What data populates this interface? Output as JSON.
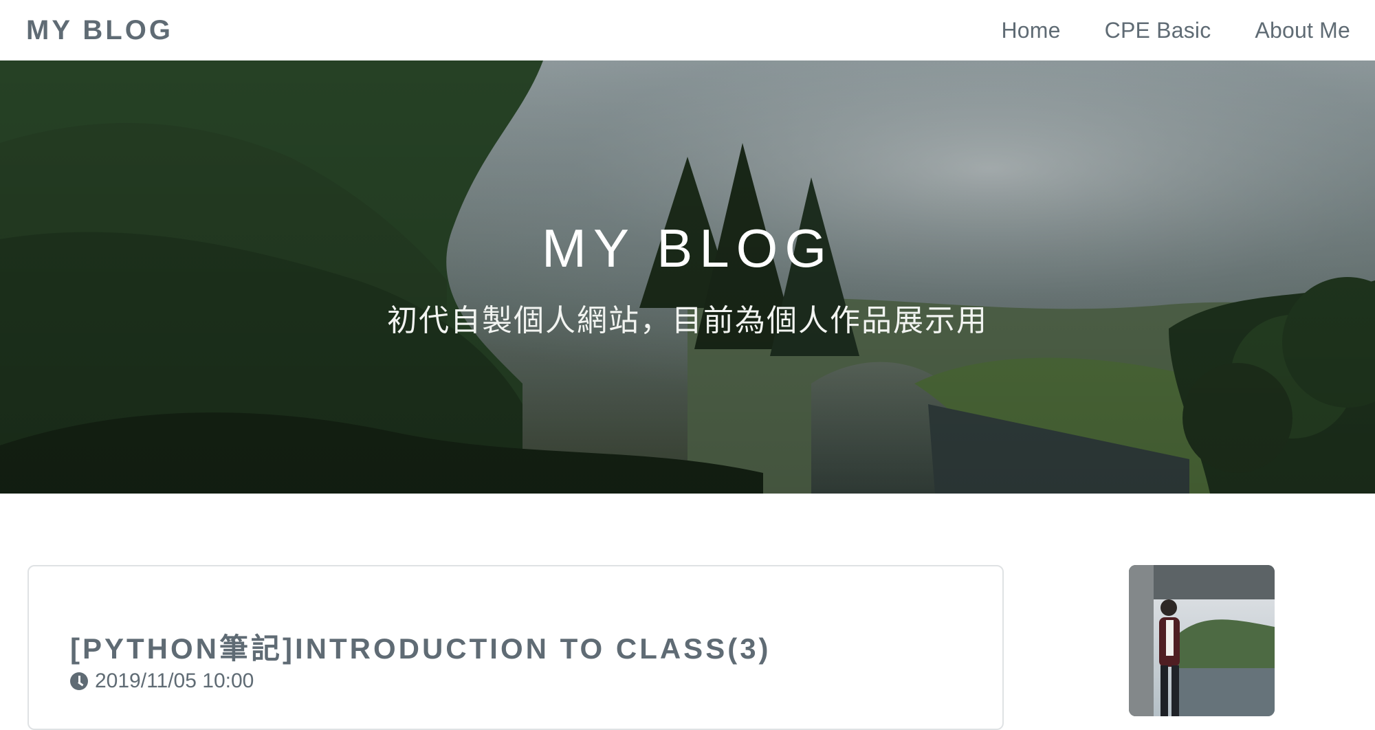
{
  "navbar": {
    "brand": "MY BLOG",
    "links": [
      "Home",
      "CPE Basic",
      "About Me"
    ]
  },
  "hero": {
    "title": "MY BLOG",
    "subtitle": "初代自製個人網站，目前為個人作品展示用"
  },
  "post": {
    "title": "[PYTHON筆記]INTRODUCTION TO CLASS(3)",
    "date": "2019/11/05 10:00"
  },
  "icons": {
    "clock": "clock-icon"
  },
  "colors": {
    "text": "#5f6b74",
    "card_border": "#dfe2e4",
    "hero_text": "#ffffff"
  }
}
